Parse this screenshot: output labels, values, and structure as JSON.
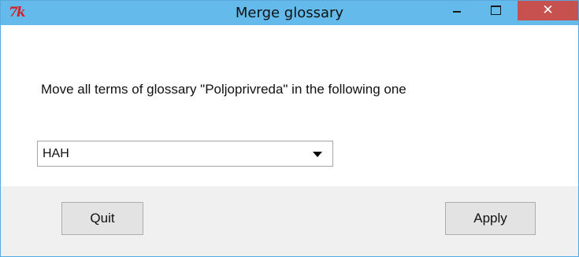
{
  "window": {
    "title": "Merge glossary",
    "icon_name": "tk-feather-icon",
    "icon_text": "7k",
    "buttons": {
      "minimize": "minimize-icon",
      "maximize": "maximize-icon",
      "close": "close-icon",
      "close_glyph": "✕"
    },
    "colors": {
      "titlebar": "#64bbeb",
      "close": "#c6514e",
      "footer": "#f0f0f0"
    }
  },
  "dialog": {
    "message": "Move all terms of glossary \"Poljoprivreda\" in the following one",
    "target_glossary": {
      "selected": "HAH"
    },
    "buttons": {
      "quit": "Quit",
      "apply": "Apply"
    }
  }
}
